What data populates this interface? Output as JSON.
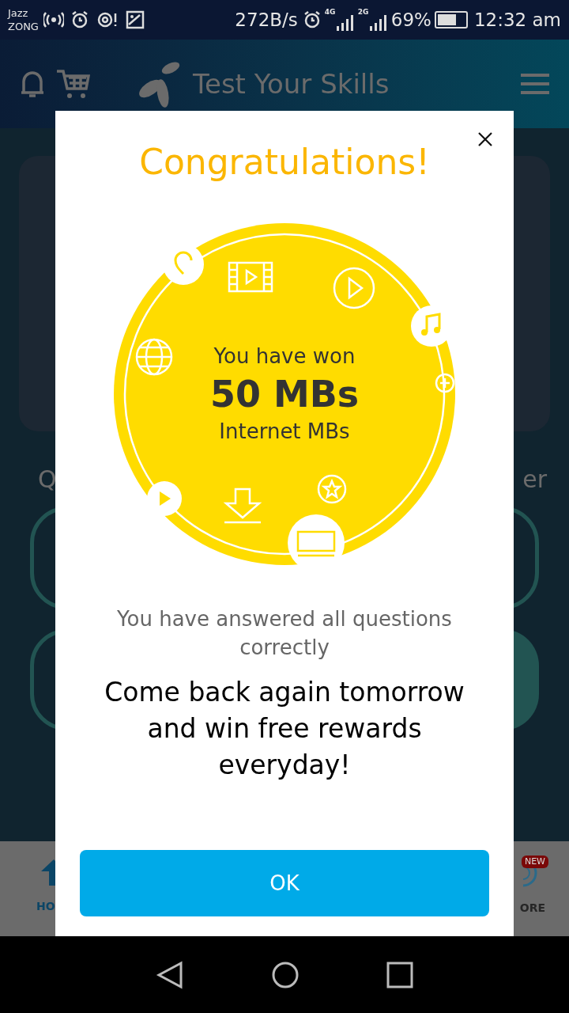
{
  "status_bar": {
    "carriers": [
      "Jazz",
      "ZONG"
    ],
    "speed": "272B/s",
    "network_1": "4G",
    "network_2": "2G",
    "battery": "69%",
    "time": "12:32 am"
  },
  "header": {
    "title": "Test Your Skills"
  },
  "background": {
    "left_label": "Q",
    "right_label": "er",
    "nav": [
      {
        "label": "HO"
      },
      {
        "label": "ORE",
        "badge": "NEW"
      }
    ]
  },
  "dialog": {
    "title": "Congratulations!",
    "prize": {
      "intro": "You have won",
      "amount": "50 MBs",
      "type": "Internet MBs"
    },
    "message": "You have answered all questions correctly",
    "callout": "Come back again tomorrow and win free rewards everyday!",
    "button": "OK"
  }
}
